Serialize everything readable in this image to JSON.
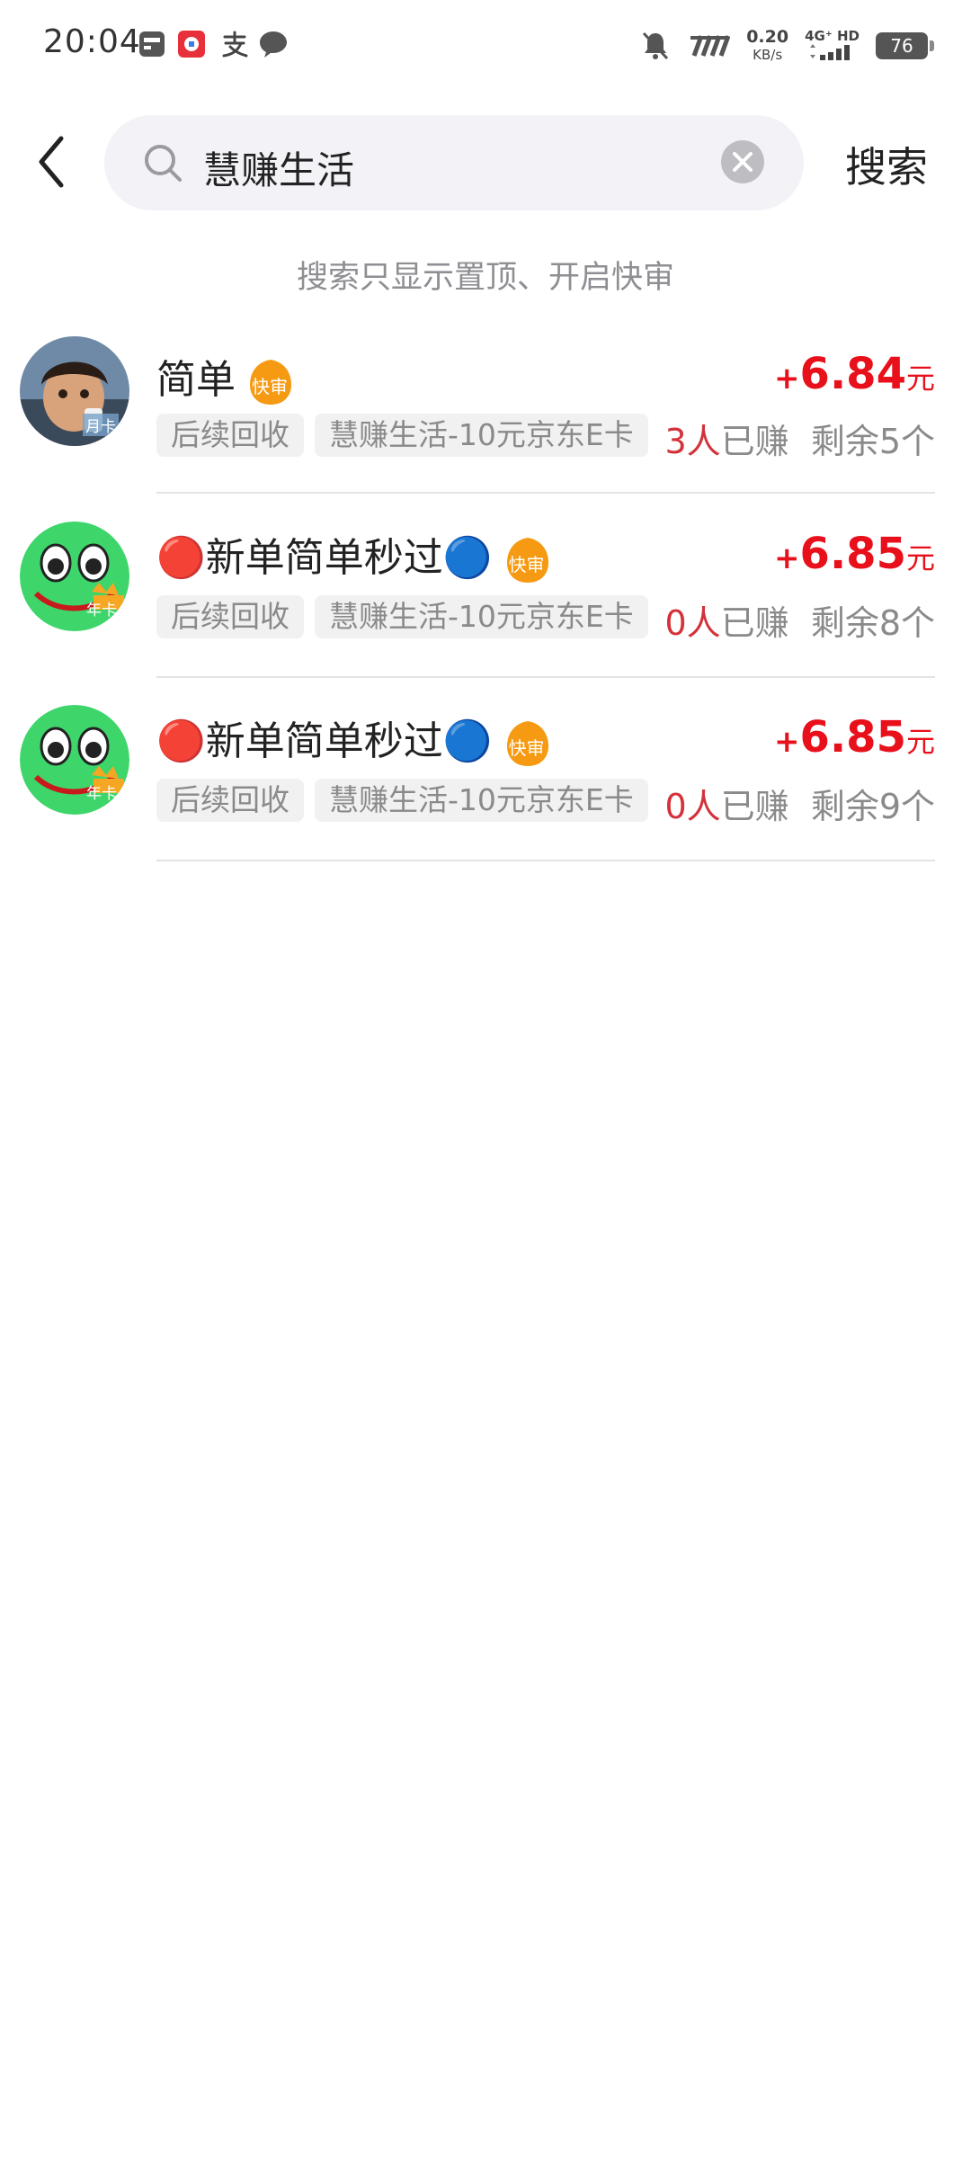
{
  "status_bar": {
    "time": "20:04",
    "speed_value": "0.20",
    "speed_unit": "KB/s",
    "network_label": "4G⁺ HD",
    "battery": "76",
    "icons": [
      "calendar-icon",
      "app-icon",
      "alipay-icon",
      "message-icon",
      "mute-icon",
      "nfc-icon",
      "signal-icon",
      "battery-icon"
    ]
  },
  "search": {
    "query": "慧赚生活",
    "action_label": "搜索"
  },
  "hint": "搜索只显示置顶、开启快审",
  "items": [
    {
      "title": "简单",
      "badge": "快审",
      "price_sign": "+",
      "price": "6.84",
      "price_unit": "元",
      "tag1": "后续回收",
      "tag2": "慧赚生活-10元京东E卡",
      "earned_count": "3人",
      "earned_label": "已赚",
      "remaining": "剩余5个",
      "avatar_label": "月卡"
    },
    {
      "title": "🔴新单简单秒过🔵",
      "badge": "快审",
      "price_sign": "+",
      "price": "6.85",
      "price_unit": "元",
      "tag1": "后续回收",
      "tag2": "慧赚生活-10元京东E卡",
      "earned_count": "0人",
      "earned_label": "已赚",
      "remaining": "剩余8个",
      "avatar_label": "年卡"
    },
    {
      "title": "🔴新单简单秒过🔵",
      "badge": "快审",
      "price_sign": "+",
      "price": "6.85",
      "price_unit": "元",
      "tag1": "后续回收",
      "tag2": "慧赚生活-10元京东E卡",
      "earned_count": "0人",
      "earned_label": "已赚",
      "remaining": "剩余9个",
      "avatar_label": "年卡"
    }
  ],
  "colors": {
    "price": "#e8101a",
    "earned": "#d4323a",
    "badge": "#f59a12",
    "search_bg": "#f2f2f7"
  }
}
